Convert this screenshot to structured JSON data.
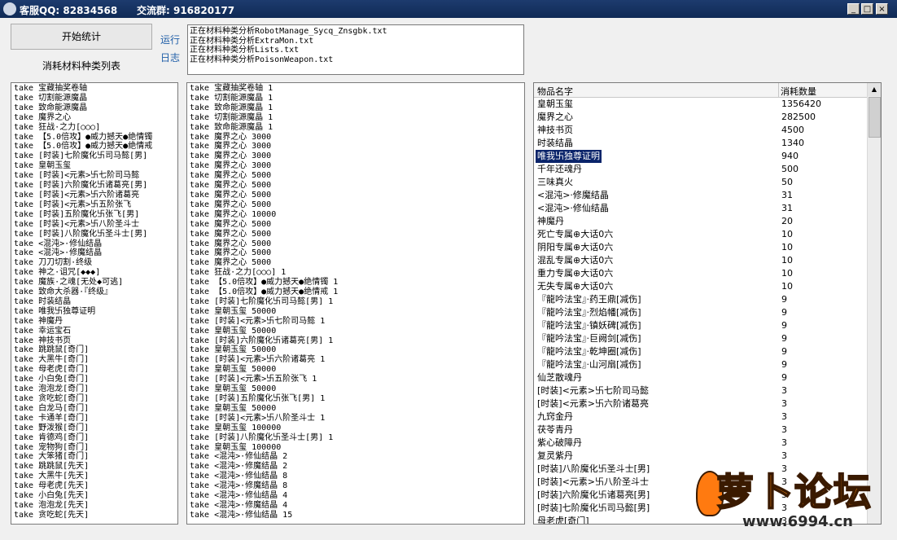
{
  "titlebar": {
    "service_qq": "客服QQ: 82834568",
    "group": "交流群: 916820177",
    "min": "_",
    "max": "□",
    "close": "×"
  },
  "controls": {
    "start_button": "开始统计",
    "list_label": "消耗材料种类列表",
    "run_link": "运行",
    "log_link": "日志"
  },
  "log_lines": [
    "正在材料种类分析RobotManage_Sycq_Znsgbk.txt",
    "正在材料种类分析ExtraMon.txt",
    "正在材料种类分析Lists.txt",
    "正在材料种类分析PoisonWeapon.txt"
  ],
  "list1": [
    "take 宝藏抽奖卷轴",
    "take 切割能源魔晶",
    "take 致命能源魔晶",
    "take 魔界之心",
    "take 狂战·之力[○○○]",
    "take 【5.0倍攻】●威力撼天●绝情镯",
    "take 【5.0倍攻】●威力撼天●绝情戒",
    "take [时装]七阶魔化卐司马懿[男]",
    "take 皇朝玉玺",
    "take [时装]<元素>卐七阶司马懿",
    "take [时装]六阶魔化卐诸葛亮[男]",
    "take [时装]<元素>卐六阶诸葛亮",
    "take [时装]<元素>卐五阶张飞",
    "take [时装]五阶魔化卐张飞[男]",
    "take [时装]<元素>卐八阶圣斗士",
    "take [时装]八阶魔化卐圣斗士[男]",
    "take <混沌>·修仙结晶",
    "take <混沌>·修魔结晶",
    "take 刀刀切割·终级",
    "take 神之·诅咒[◆◆◆]",
    "take 魔族·之魂[无处◆可逃]",
    "take 致命大杀器·『终级』",
    "take 时装结晶",
    "take 唯我卐独尊证明",
    "take 神魔丹",
    "take 幸运宝石",
    "take 神技书页",
    "take 跳跳鼠[奇门]",
    "take 大黑牛[奇门]",
    "take 母老虎[奇门]",
    "take 小白兔[奇门]",
    "take 泡泡龙[奇门]",
    "take 贪吃蛇[奇门]",
    "take 白龙马[奇门]",
    "take 卡通羊[奇门]",
    "take 野泼猴[奇门]",
    "take 肯德鸡[奇门]",
    "take 宠物狗[奇门]",
    "take 大笨猪[奇门]",
    "take 跳跳鼠[先天]",
    "take 大黑牛[先天]",
    "take 母老虎[先天]",
    "take 小白兔[先天]",
    "take 泡泡龙[先天]",
    "take 贪吃蛇[先天]"
  ],
  "list2": [
    "take 宝藏抽奖卷轴 1",
    "take 切割能源魔晶 1",
    "take 致命能源魔晶 1",
    "take 切割能源魔晶 1",
    "take 致命能源魔晶 1",
    "take 魔界之心 3000",
    "take 魔界之心 3000",
    "take 魔界之心 3000",
    "take 魔界之心 3000",
    "take 魔界之心 5000",
    "take 魔界之心 5000",
    "take 魔界之心 5000",
    "take 魔界之心 5000",
    "take 魔界之心 10000",
    "take 魔界之心 5000",
    "take 魔界之心 5000",
    "take 魔界之心 5000",
    "take 魔界之心 5000",
    "take 魔界之心 5000",
    "take 狂战·之力[○○○] 1",
    "take 【5.0倍攻】●威力撼天●绝情镯 1",
    "take 【5.0倍攻】●威力撼天●绝情戒 1",
    "take [时装]七阶魔化卐司马懿[男] 1",
    "take 皇朝玉玺 50000",
    "take [时装]<元素>卐七阶司马懿 1",
    "take 皇朝玉玺 50000",
    "take [时装]六阶魔化卐诸葛亮[男] 1",
    "take 皇朝玉玺 50000",
    "take [时装]<元素>卐六阶诸葛亮 1",
    "take 皇朝玉玺 50000",
    "take [时装]<元素>卐五阶张飞 1",
    "take 皇朝玉玺 50000",
    "take [时装]五阶魔化卐张飞[男] 1",
    "take 皇朝玉玺 50000",
    "take [时装]<元素>卐八阶圣斗士 1",
    "take 皇朝玉玺 100000",
    "take [时装]八阶魔化卐圣斗士[男] 1",
    "take 皇朝玉玺 100000",
    "take <混沌>·修仙结晶 2",
    "take <混沌>·修魔结晶 2",
    "take <混沌>·修仙结晶 8",
    "take <混沌>·修魔结晶 8",
    "take <混沌>·修仙结晶 4",
    "take <混沌>·修魔结晶 4",
    "take <混沌>·修仙结晶 15"
  ],
  "grid": {
    "col_name": "物品名字",
    "col_count": "消耗数量",
    "rows": [
      {
        "name": "皇朝玉玺",
        "count": "1356420"
      },
      {
        "name": "魔界之心",
        "count": "282500"
      },
      {
        "name": "神技书页",
        "count": "4500"
      },
      {
        "name": "时装结晶",
        "count": "1340"
      },
      {
        "name": "唯我卐独尊证明",
        "count": "940"
      },
      {
        "name": "千年还魂丹",
        "count": "500"
      },
      {
        "name": "三味真火",
        "count": "50"
      },
      {
        "name": "<混沌>·修魔结晶",
        "count": "31"
      },
      {
        "name": "<混沌>·修仙结晶",
        "count": "31"
      },
      {
        "name": "神魔丹",
        "count": "20"
      },
      {
        "name": "死亡专属⊕大话0六",
        "count": "10"
      },
      {
        "name": "阴阳专属⊕大话0六",
        "count": "10"
      },
      {
        "name": "混乱专属⊕大话0六",
        "count": "10"
      },
      {
        "name": "重力专属⊕大话0六",
        "count": "10"
      },
      {
        "name": "无失专属⊕大话0六",
        "count": "10"
      },
      {
        "name": "『龍吟法宝』·药王鼎[减伤]",
        "count": "9"
      },
      {
        "name": "『龍吟法宝』·烈焰幡[减伤]",
        "count": "9"
      },
      {
        "name": "『龍吟法宝』·镇妖碑[减伤]",
        "count": "9"
      },
      {
        "name": "『龍吟法宝』·巨阙剑[减伤]",
        "count": "9"
      },
      {
        "name": "『龍吟法宝』·乾坤圈[减伤]",
        "count": "9"
      },
      {
        "name": "『龍吟法宝』·山河扇[减伤]",
        "count": "9"
      },
      {
        "name": "仙芝散魂丹",
        "count": "9"
      },
      {
        "name": "[时装]<元素>卐七阶司马懿",
        "count": "3"
      },
      {
        "name": "[时装]<元素>卐六阶诸葛亮",
        "count": "3"
      },
      {
        "name": "九窍金丹",
        "count": "3"
      },
      {
        "name": "茯苓青丹",
        "count": "3"
      },
      {
        "name": "紫心破障丹",
        "count": "3"
      },
      {
        "name": "复灵紫丹",
        "count": "3"
      },
      {
        "name": "[时装]八阶魔化卐圣斗士[男]",
        "count": "3"
      },
      {
        "name": "[时装]<元素>卐八阶圣斗士",
        "count": "3"
      },
      {
        "name": "[时装]六阶魔化卐诸葛亮[男]",
        "count": "3"
      },
      {
        "name": "[时装]七阶魔化卐司马懿[男]",
        "count": "3"
      },
      {
        "name": "母老虎[奇门]",
        "count": "3"
      }
    ],
    "selected_index": 4
  },
  "watermark": {
    "text": "萝卜论坛",
    "site": "www.6994.cn"
  }
}
